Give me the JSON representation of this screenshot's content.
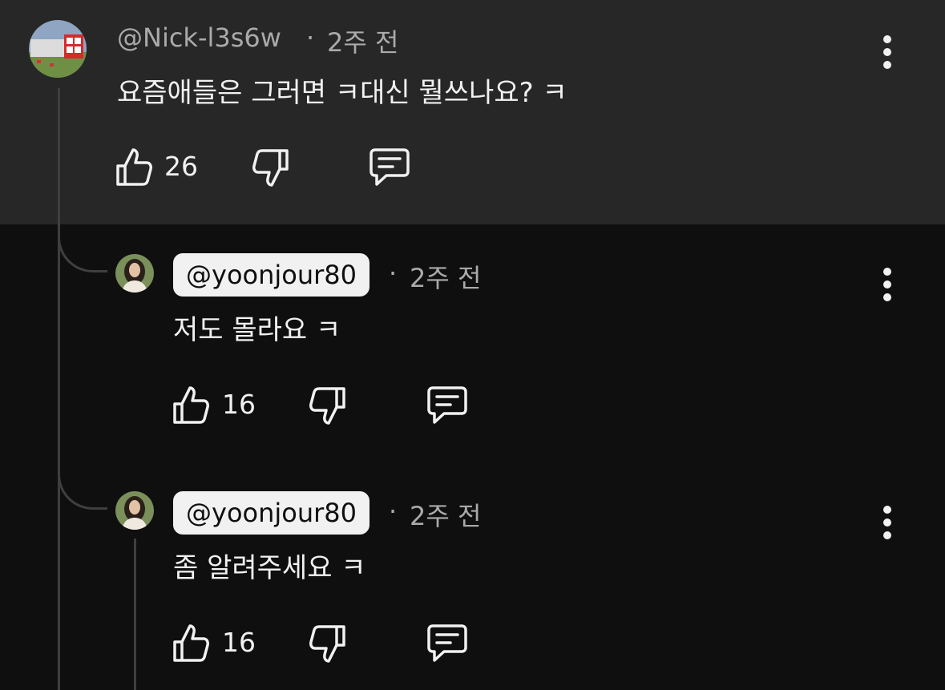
{
  "comments": [
    {
      "handle": "@Nick-l3s6w",
      "time": "2주 전",
      "text": "요즘애들은 그러면 ㅋ대신 뭘쓰나요? ㅋ",
      "likes": "26"
    },
    {
      "handle": "@yoonjour80",
      "time": "2주 전",
      "text": "저도 몰라요 ㅋ",
      "likes": "16"
    },
    {
      "handle": "@yoonjour80",
      "time": "2주 전",
      "text": "좀 알려주세요 ㅋ",
      "likes": "16"
    }
  ],
  "icons": {
    "like": "thumbs-up-icon",
    "dislike": "thumbs-down-icon",
    "reply": "comment-icon",
    "more": "more-vertical-icon"
  },
  "colors": {
    "top_background": "#272727",
    "page_background": "#0f0f0f",
    "text": "#f1f1f1",
    "secondary_text": "#aaaaaa",
    "creator_pill": "#f1f1f1"
  }
}
